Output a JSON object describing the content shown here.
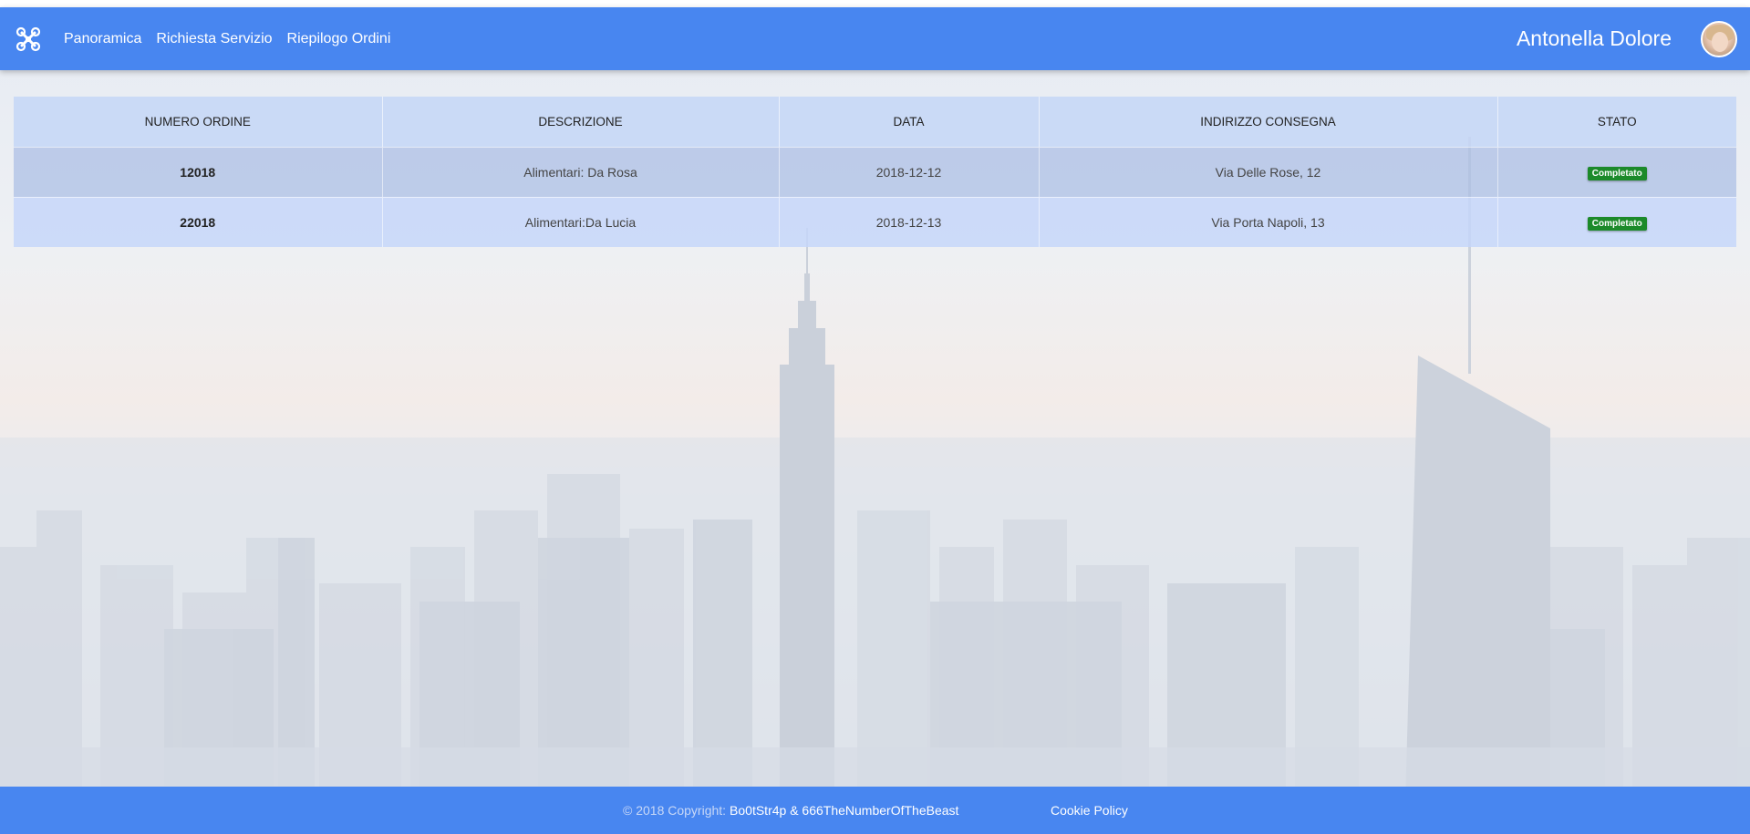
{
  "navbar": {
    "links": [
      "Panoramica",
      "Richiesta Servizio",
      "Riepilogo Ordini"
    ],
    "user_name": "Antonella Dolore",
    "logo_icon": "drone-icon"
  },
  "table": {
    "headers": [
      "NUMERO ORDINE",
      "DESCRIZIONE",
      "DATA",
      "INDIRIZZO CONSEGNA",
      "STATO"
    ],
    "rows": [
      {
        "numero": "12018",
        "descrizione": "Alimentari: Da Rosa",
        "data": "2018-12-12",
        "indirizzo": "Via Delle Rose, 12",
        "stato": "Completato"
      },
      {
        "numero": "22018",
        "descrizione": "Alimentari:Da Lucia",
        "data": "2018-12-13",
        "indirizzo": "Via Porta Napoli, 13",
        "stato": "Completato"
      }
    ]
  },
  "footer": {
    "copyright_prefix": "© 2018 Copyright:",
    "authors": "Bo0tStr4p & 666TheNumberOfTheBeast",
    "cookie_policy": "Cookie Policy"
  },
  "colors": {
    "primary": "#4886f0",
    "badge_success": "#1c8a2a"
  }
}
